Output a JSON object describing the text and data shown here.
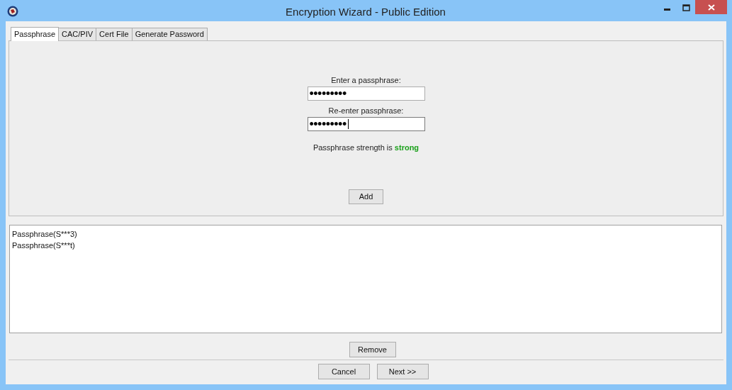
{
  "window": {
    "title": "Encryption Wizard - Public Edition"
  },
  "tabs": [
    {
      "label": "Passphrase",
      "selected": true
    },
    {
      "label": "CAC/PIV",
      "selected": false
    },
    {
      "label": "Cert File",
      "selected": false
    },
    {
      "label": "Generate Password",
      "selected": false
    }
  ],
  "passphrase_fields": [
    {
      "label": "Enter a passphrase:",
      "value": "•••••••••",
      "focused": false
    },
    {
      "label": "Re-enter passphrase:",
      "value": "•••••••••",
      "focused": true
    }
  ],
  "strength": {
    "text": "Passphrase strength is **strong**"
  },
  "add_button": "Add",
  "recipients": [
    "Passphrase(S***3)",
    "Passphrase(S***t)"
  ],
  "remove_button": "Remove",
  "footer_buttons": [
    "Cancel",
    "Next >>"
  ]
}
